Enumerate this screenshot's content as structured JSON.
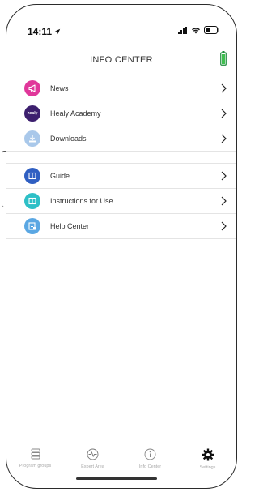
{
  "status_bar": {
    "time": "14:11"
  },
  "header": {
    "title": "INFO CENTER"
  },
  "menu": {
    "group1": [
      {
        "label": "News",
        "icon": "megaphone-icon",
        "color": "#e0379a"
      },
      {
        "label": "Healy Academy",
        "icon": "healy-academy-logo",
        "color": "#3c1f6e"
      },
      {
        "label": "Downloads",
        "icon": "download-icon",
        "color": "#a9c8ea"
      }
    ],
    "group2": [
      {
        "label": "Guide",
        "icon": "book-icon",
        "color": "#2f5fc2"
      },
      {
        "label": "Instructions for Use",
        "icon": "book-icon",
        "color": "#2ec0c7"
      },
      {
        "label": "Help Center",
        "icon": "help-book-icon",
        "color": "#5aa7e3"
      }
    ]
  },
  "bottom_nav": {
    "tabs": [
      {
        "label": "Program groups",
        "icon": "list-icon"
      },
      {
        "label": "Expert Area",
        "icon": "pulse-icon"
      },
      {
        "label": "Info Center",
        "icon": "info-icon"
      },
      {
        "label": "Settings",
        "icon": "gear-icon",
        "active": true
      }
    ]
  },
  "logo_text": "healy"
}
